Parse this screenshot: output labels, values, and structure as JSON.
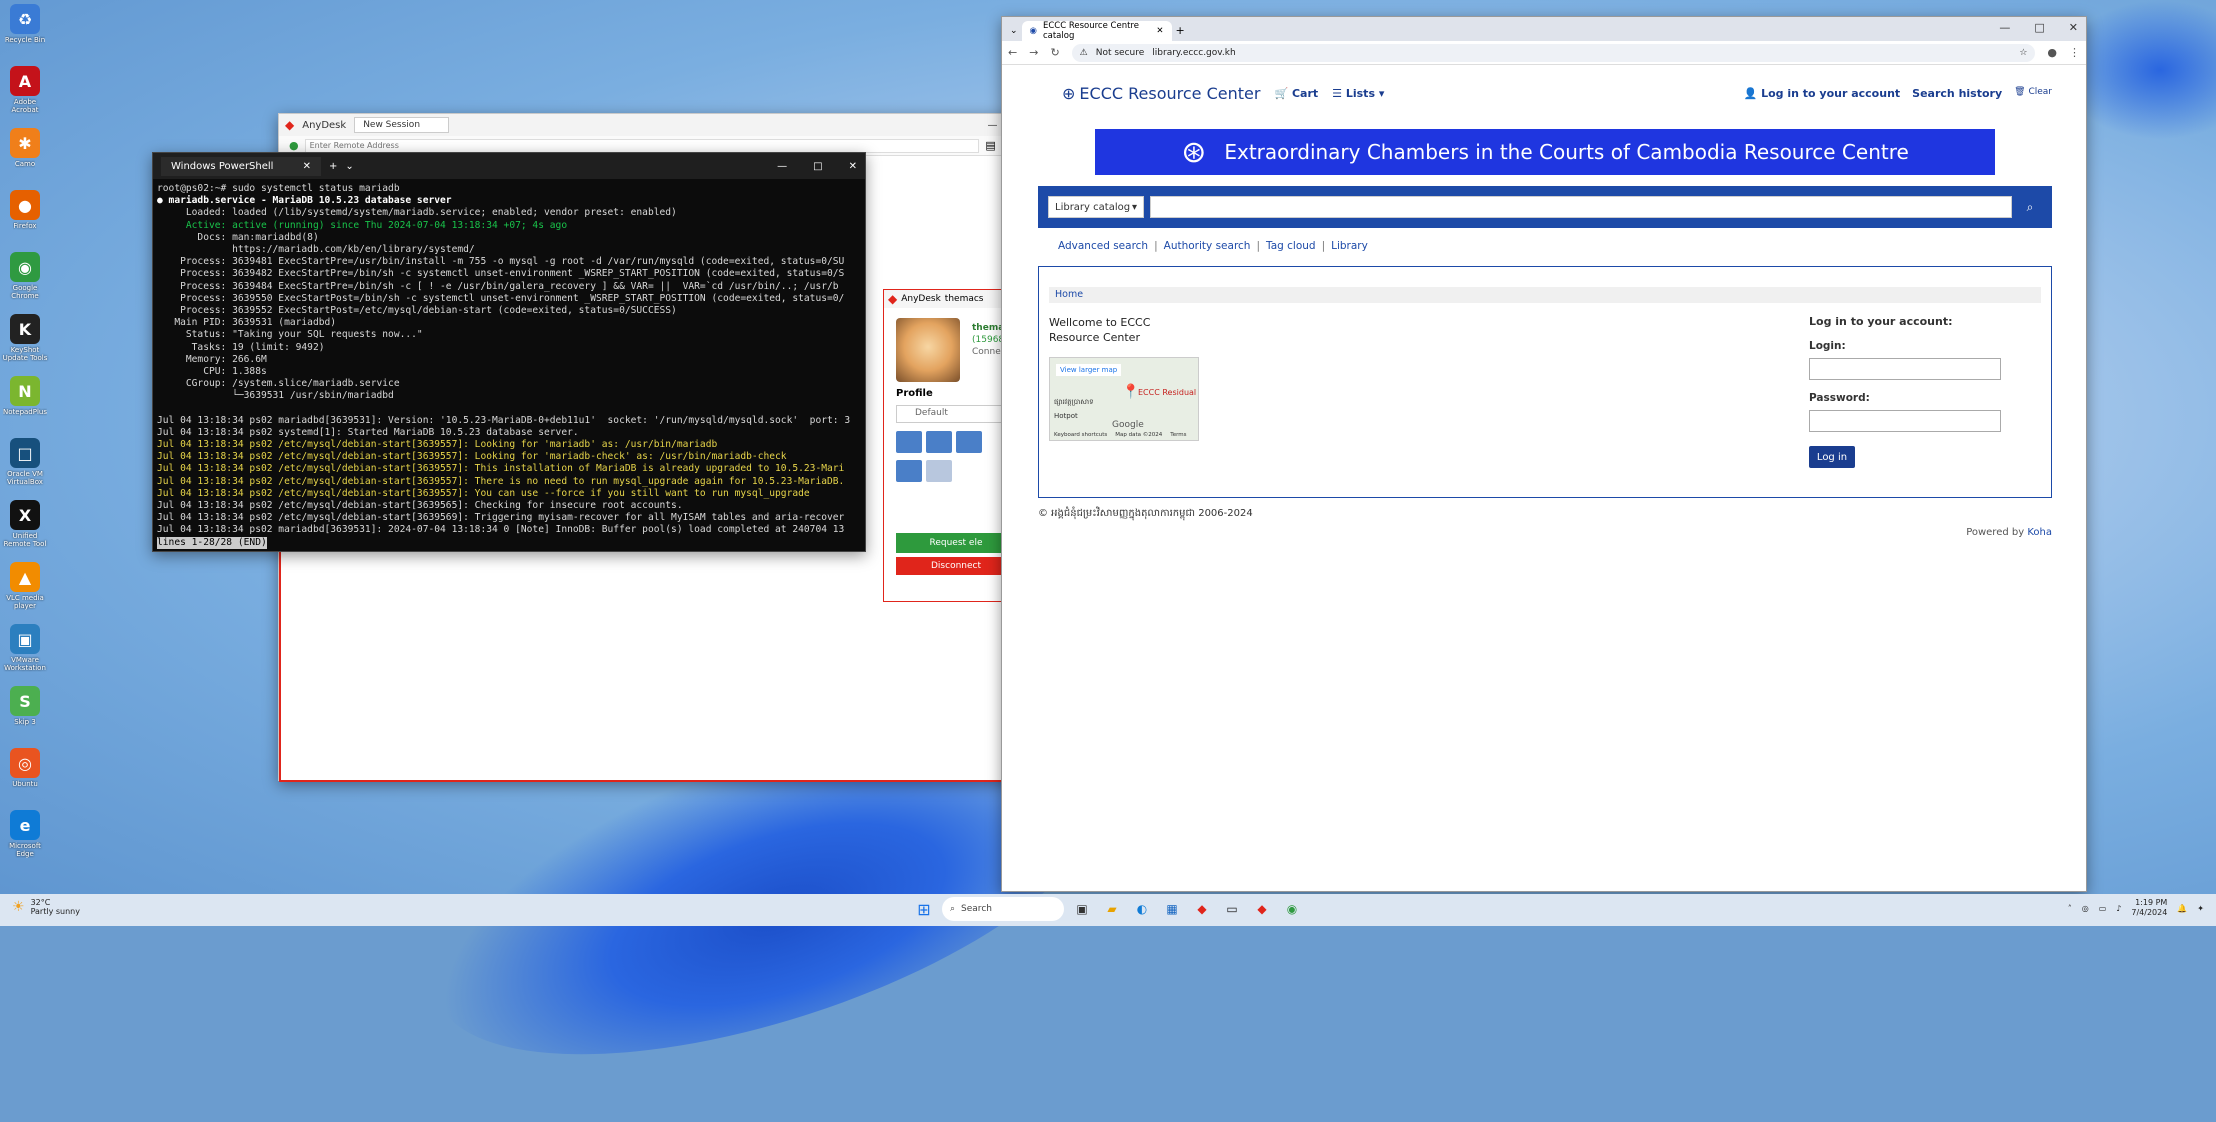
{
  "desktop": {
    "icons": [
      {
        "label": "Recycle Bin",
        "glyph": "♻",
        "color": "#3a7bd5"
      },
      {
        "label": "Adobe Acrobat",
        "glyph": "A",
        "color": "#c4121a"
      },
      {
        "label": "Camo",
        "glyph": "✱",
        "color": "#f07f1a"
      },
      {
        "label": "Firefox",
        "glyph": "●",
        "color": "#e66000"
      },
      {
        "label": "Google Chrome",
        "glyph": "◉",
        "color": "#2f9a41"
      },
      {
        "label": "KeyShot Update Tools",
        "glyph": "K",
        "color": "#222"
      },
      {
        "label": "NotepadPlus",
        "glyph": "N",
        "color": "#7bb62f"
      },
      {
        "label": "Oracle VM VirtualBox",
        "glyph": "□",
        "color": "#17507d"
      },
      {
        "label": "Unified Remote Tool",
        "glyph": "X",
        "color": "#111"
      },
      {
        "label": "VLC media player",
        "glyph": "▲",
        "color": "#f28c00"
      },
      {
        "label": "VMware Workstation",
        "glyph": "▣",
        "color": "#2c7fbf"
      },
      {
        "label": "Skip 3",
        "glyph": "S",
        "color": "#4caf50"
      },
      {
        "label": "Ubuntu",
        "glyph": "◎",
        "color": "#e95420"
      },
      {
        "label": "Microsoft Edge",
        "glyph": "e",
        "color": "#0f7bd6"
      }
    ]
  },
  "anydesk": {
    "app": "AnyDesk",
    "tab": "New Session",
    "placeholder": "Enter Remote Address",
    "panel_app": "AnyDesk",
    "panel_tab": "themacs",
    "user_name": "thema",
    "user_id": "(15968",
    "status": "Connec",
    "profile_label": "Profile",
    "profile_value": "Default",
    "request_label": "Request ele",
    "disconnect_label": "Disconnect"
  },
  "powershell": {
    "title": "Windows PowerShell",
    "lines": [
      {
        "t": "root@ps02:~# sudo systemctl status mariadb",
        "c": ""
      },
      {
        "t": "● mariadb.service - MariaDB 10.5.23 database server",
        "c": "w"
      },
      {
        "t": "     Loaded: loaded (/lib/systemd/system/mariadb.service; enabled; vendor preset: enabled)",
        "c": ""
      },
      {
        "t": "     Active: active (running) since Thu 2024-07-04 13:18:34 +07; 4s ago",
        "c": "g"
      },
      {
        "t": "       Docs: man:mariadbd(8)",
        "c": ""
      },
      {
        "t": "             https://mariadb.com/kb/en/library/systemd/",
        "c": ""
      },
      {
        "t": "    Process: 3639481 ExecStartPre=/usr/bin/install -m 755 -o mysql -g root -d /var/run/mysqld (code=exited, status=0/SU",
        "c": ""
      },
      {
        "t": "    Process: 3639482 ExecStartPre=/bin/sh -c systemctl unset-environment _WSREP_START_POSITION (code=exited, status=0/S",
        "c": ""
      },
      {
        "t": "    Process: 3639484 ExecStartPre=/bin/sh -c [ ! -e /usr/bin/galera_recovery ] && VAR= ||  VAR=`cd /usr/bin/..; /usr/b",
        "c": ""
      },
      {
        "t": "    Process: 3639550 ExecStartPost=/bin/sh -c systemctl unset-environment _WSREP_START_POSITION (code=exited, status=0/",
        "c": ""
      },
      {
        "t": "    Process: 3639552 ExecStartPost=/etc/mysql/debian-start (code=exited, status=0/SUCCESS)",
        "c": ""
      },
      {
        "t": "   Main PID: 3639531 (mariadbd)",
        "c": ""
      },
      {
        "t": "     Status: \"Taking your SQL requests now...\"",
        "c": ""
      },
      {
        "t": "      Tasks: 19 (limit: 9492)",
        "c": ""
      },
      {
        "t": "     Memory: 266.6M",
        "c": ""
      },
      {
        "t": "        CPU: 1.388s",
        "c": ""
      },
      {
        "t": "     CGroup: /system.slice/mariadb.service",
        "c": ""
      },
      {
        "t": "             └─3639531 /usr/sbin/mariadbd",
        "c": ""
      },
      {
        "t": "",
        "c": ""
      },
      {
        "t": "Jul 04 13:18:34 ps02 mariadbd[3639531]: Version: '10.5.23-MariaDB-0+deb11u1'  socket: '/run/mysqld/mysqld.sock'  port: 3",
        "c": ""
      },
      {
        "t": "Jul 04 13:18:34 ps02 systemd[1]: Started MariaDB 10.5.23 database server.",
        "c": ""
      },
      {
        "t": "Jul 04 13:18:34 ps02 /etc/mysql/debian-start[3639557]: Looking for 'mariadb' as: /usr/bin/mariadb",
        "c": "y"
      },
      {
        "t": "Jul 04 13:18:34 ps02 /etc/mysql/debian-start[3639557]: Looking for 'mariadb-check' as: /usr/bin/mariadb-check",
        "c": "y"
      },
      {
        "t": "Jul 04 13:18:34 ps02 /etc/mysql/debian-start[3639557]: This installation of MariaDB is already upgraded to 10.5.23-Mari",
        "c": "y"
      },
      {
        "t": "Jul 04 13:18:34 ps02 /etc/mysql/debian-start[3639557]: There is no need to run mysql_upgrade again for 10.5.23-MariaDB.",
        "c": "y"
      },
      {
        "t": "Jul 04 13:18:34 ps02 /etc/mysql/debian-start[3639557]: You can use --force if you still want to run mysql_upgrade",
        "c": "y"
      },
      {
        "t": "Jul 04 13:18:34 ps02 /etc/mysql/debian-start[3639565]: Checking for insecure root accounts.",
        "c": ""
      },
      {
        "t": "Jul 04 13:18:34 ps02 /etc/mysql/debian-start[3639569]: Triggering myisam-recover for all MyISAM tables and aria-recover",
        "c": ""
      },
      {
        "t": "Jul 04 13:18:34 ps02 mariadbd[3639531]: 2024-07-04 13:18:34 0 [Note] InnoDB: Buffer pool(s) load completed at 240704 13",
        "c": ""
      },
      {
        "t": "lines 1-28/28 (END)",
        "c": "inv"
      }
    ]
  },
  "chrome": {
    "tab_title": "ECCC Resource Centre catalog",
    "security": "Not secure",
    "url": "library.eccc.gov.kh"
  },
  "koha": {
    "logo_text": "ECCC Resource Center",
    "cart": "Cart",
    "lists": "Lists",
    "login_link": "Log in to your account",
    "search_history": "Search history",
    "clear": "Clear",
    "banner": "Extraordinary Chambers in the Courts of Cambodia Resource  Centre",
    "search_scope": "Library catalog",
    "links": [
      "Advanced search",
      "Authority search",
      "Tag cloud",
      "Library"
    ],
    "breadcrumb": "Home",
    "welcome": "Wellcome to ECCC Resource Center",
    "map": {
      "view_larger": "View larger map",
      "pin_label": "ECCC Residual",
      "place1": "ផ្សារវត្តប្រាសាទ",
      "place2": "Hotpot",
      "google": "Google",
      "footer1": "Keyboard shortcuts",
      "footer2": "Map data ©2024",
      "footer3": "Terms"
    },
    "login_title": "Log in to your account:",
    "login_label": "Login:",
    "password_label": "Password:",
    "login_button": "Log in",
    "footer": "© អង្គជំនុំជម្រះវិសាមញ្ញក្នុងតុលាការកម្ពុជា 2006-2024",
    "powered": "Powered by",
    "koha": "Koha"
  },
  "taskbar": {
    "temp": "32°C",
    "weather": "Partly sunny",
    "search": "Search",
    "time": "1:19 PM",
    "date": "7/4/2024"
  }
}
